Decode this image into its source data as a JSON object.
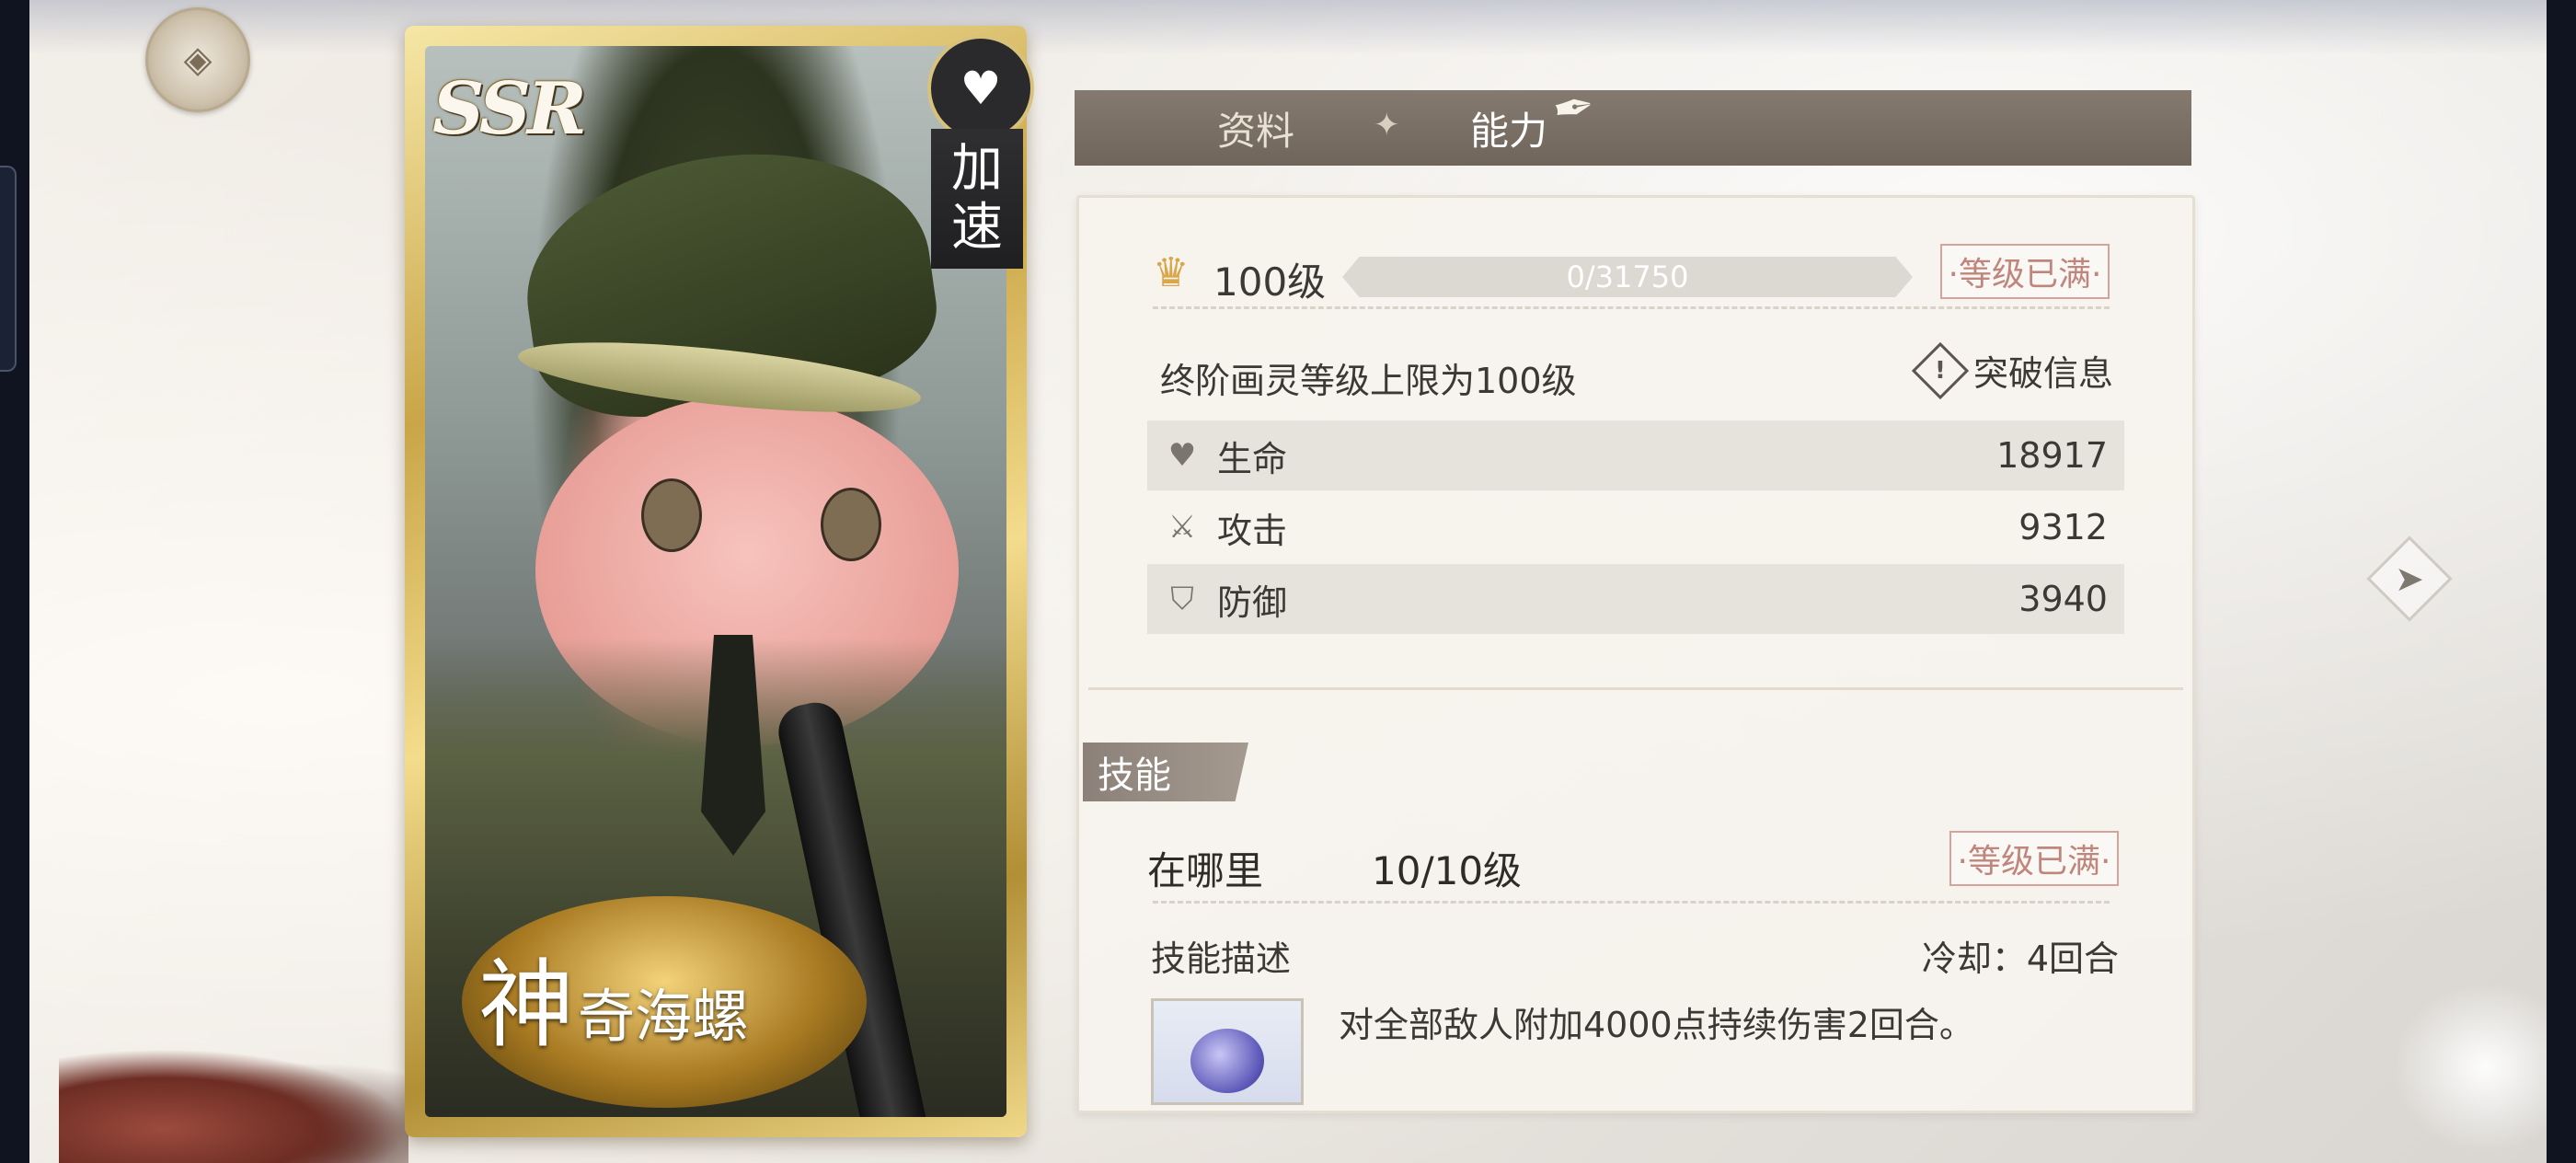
{
  "card": {
    "rarity": "SSR",
    "type_tag_1": "加",
    "type_tag_2": "速",
    "name_first": "神",
    "name_rest": "奇海螺"
  },
  "tabs": {
    "profile": "资料",
    "ability": "能力",
    "separator": "✦"
  },
  "level": {
    "label": "100级",
    "xp_text": "0/31750",
    "xp_current": 0,
    "xp_max": 31750,
    "maxed_label": "·等级已满·"
  },
  "cap_text": "终阶画灵等级上限为100级",
  "break_info": {
    "icon": "!",
    "label": "突破信息"
  },
  "stats": [
    {
      "icon": "heart-icon",
      "glyph": "♥",
      "label": "生命",
      "value": "18917"
    },
    {
      "icon": "crossed-swords-icon",
      "glyph": "⚔",
      "label": "攻击",
      "value": "9312"
    },
    {
      "icon": "shield-icon",
      "glyph": "⛉",
      "label": "防御",
      "value": "3940"
    }
  ],
  "skills": {
    "header": "技能",
    "name": "在哪里",
    "level": "10/10级",
    "maxed_label": "·等级已满·",
    "desc_label": "技能描述",
    "cooldown": "冷却：4回合",
    "description": "对全部敌人附加4000点持续伤害2回合。"
  },
  "icons": {
    "home": "◈",
    "heart_status": "♥",
    "crown": "♛",
    "pen": "✒",
    "next": "➤"
  },
  "colors": {
    "accent_gold": "#c9a548",
    "maxed_pink": "#c0867d",
    "tab_bar": "#756b61"
  }
}
